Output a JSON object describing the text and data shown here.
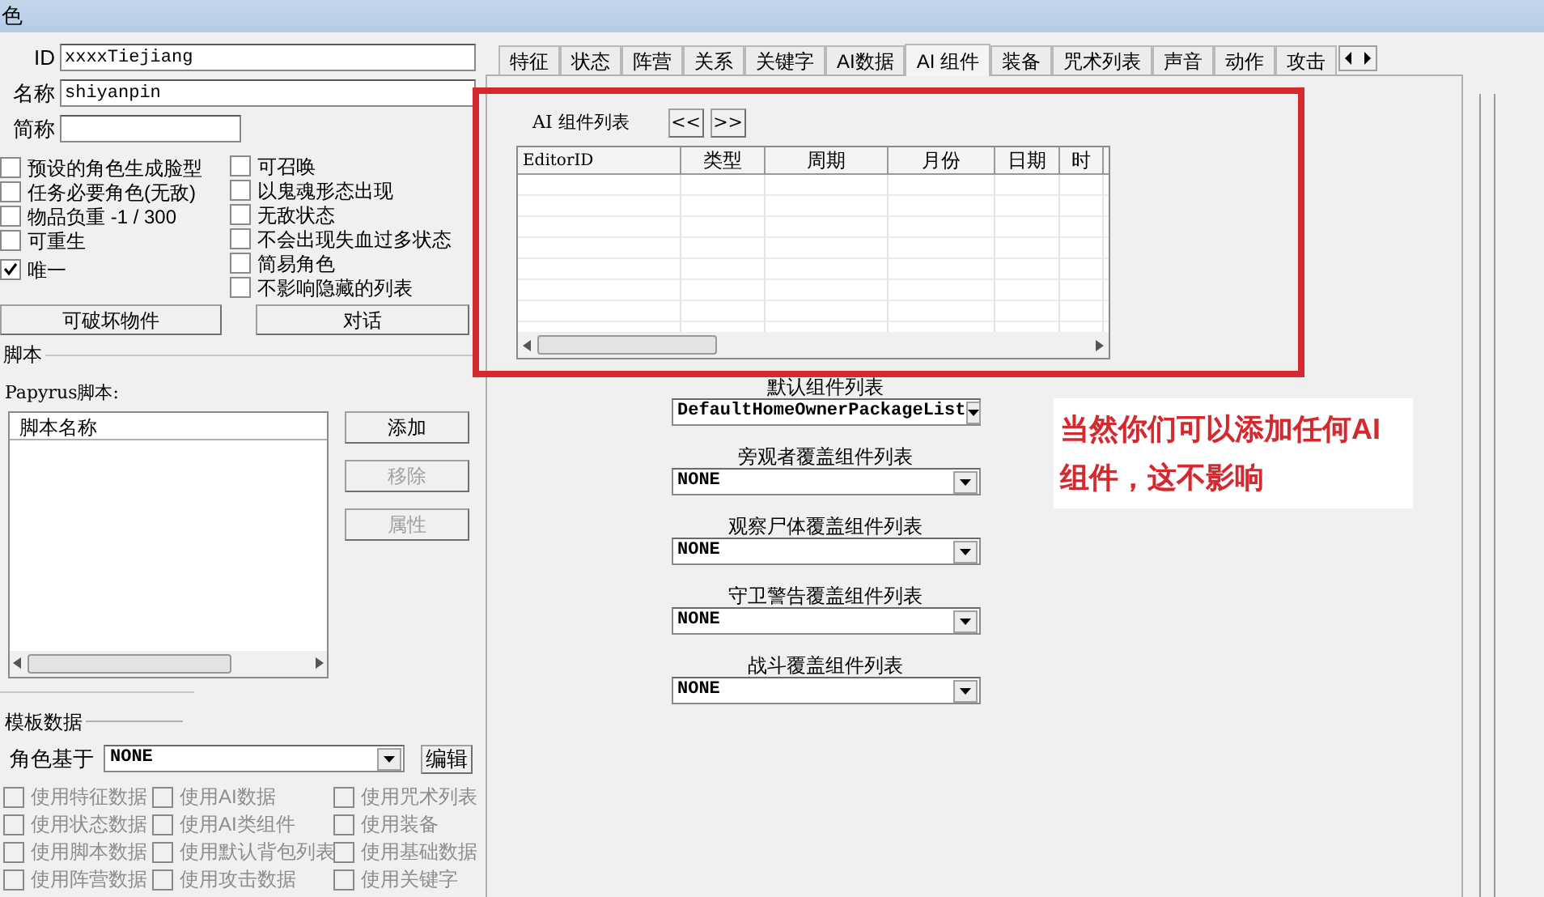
{
  "window": {
    "title": "色"
  },
  "fields": [
    {
      "label": "ID",
      "value": "xxxxTiejiang"
    },
    {
      "label": "名称",
      "value": "shiyanpin"
    },
    {
      "label": "简称"
    }
  ],
  "flags_left": [
    {
      "label": "预设的角色生成脸型",
      "checked": false
    },
    {
      "label": "任务必要角色(无敌)",
      "checked": false
    },
    {
      "label": "物品负重 -1 / 300",
      "checked": false
    },
    {
      "label": "可重生",
      "checked": false
    },
    {
      "label": "唯一",
      "checked": true
    }
  ],
  "flags_right": [
    {
      "label": "可召唤",
      "checked": false
    },
    {
      "label": "以鬼魂形态出现",
      "checked": false
    },
    {
      "label": "无敌状态",
      "checked": false
    },
    {
      "label": "不会出现失血过多状态",
      "checked": false
    },
    {
      "label": "简易角色",
      "checked": false
    },
    {
      "label": "不影响隐藏的列表",
      "checked": false
    }
  ],
  "buttons": [
    "可破坏物件",
    "对话"
  ],
  "scripts": {
    "group": "脚本",
    "label": "Papyrus脚本:",
    "column": "脚本名称",
    "buttons": [
      {
        "label": "添加",
        "disabled": false
      },
      {
        "label": "移除",
        "disabled": true
      },
      {
        "label": "属性",
        "disabled": true
      }
    ]
  },
  "template": {
    "group": "模板数据",
    "base_label": "角色基于",
    "base_value": "NONE",
    "edit": "编辑",
    "options": [
      {
        "label": "使用特征数据",
        "checked": false,
        "disabled": true
      },
      {
        "label": "使用AI数据",
        "checked": false,
        "disabled": true
      },
      {
        "label": "使用咒术列表",
        "checked": false,
        "disabled": true
      },
      {
        "label": "使用状态数据",
        "checked": false,
        "disabled": true
      },
      {
        "label": "使用AI类组件",
        "checked": false,
        "disabled": true
      },
      {
        "label": "使用装备",
        "checked": false,
        "disabled": true
      },
      {
        "label": "使用脚本数据",
        "checked": false,
        "disabled": true
      },
      {
        "label": "使用默认背包列表",
        "checked": false,
        "disabled": true
      },
      {
        "label": "使用基础数据",
        "checked": false,
        "disabled": true
      },
      {
        "label": "使用阵营数据",
        "checked": false,
        "disabled": true
      },
      {
        "label": "使用攻击数据",
        "checked": false,
        "disabled": true
      },
      {
        "label": "使用关键字",
        "checked": false,
        "disabled": true
      }
    ]
  },
  "tabs": [
    {
      "label": "特征",
      "selected": false
    },
    {
      "label": "状态",
      "selected": false
    },
    {
      "label": "阵营",
      "selected": false
    },
    {
      "label": "关系",
      "selected": false
    },
    {
      "label": "关键字",
      "selected": false
    },
    {
      "label": "AI数据",
      "selected": false
    },
    {
      "label": "AI 组件",
      "selected": true
    },
    {
      "label": "装备",
      "selected": false
    },
    {
      "label": "咒术列表",
      "selected": false
    },
    {
      "label": "声音",
      "selected": false
    },
    {
      "label": "动作",
      "selected": false
    },
    {
      "label": "攻击",
      "selected": false
    }
  ],
  "packages": {
    "label": "AI 组件列表",
    "prev": "<<",
    "next": ">>",
    "columns": [
      "EditorID",
      "类型",
      "周期",
      "月份",
      "日期",
      "时"
    ]
  },
  "overrides": [
    {
      "heading": "默认组件列表",
      "selection": "DefaultHomeOwnerPackageList"
    },
    {
      "heading": "旁观者覆盖组件列表",
      "selection": "NONE"
    },
    {
      "heading": "观察尸体覆盖组件列表",
      "selection": "NONE"
    },
    {
      "heading": "守卫警告覆盖组件列表",
      "selection": "NONE"
    },
    {
      "heading": "战斗覆盖组件列表",
      "selection": "NONE"
    }
  ],
  "annotation": "当然你们可以添加任何AI组件，这不影响"
}
